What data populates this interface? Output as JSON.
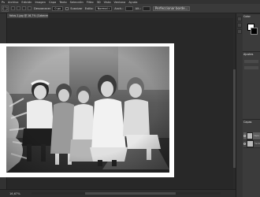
{
  "menu": [
    "Ps",
    "Archivo",
    "Edición",
    "Imagen",
    "Capa",
    "Texto",
    "Selección",
    "Filtro",
    "3D",
    "Vista",
    "Ventana",
    "Ayuda"
  ],
  "options": {
    "feather_label": "Desvanecer",
    "feather_value": "0 px",
    "antialias_label": "Suavizar",
    "style_label": "Estilo:",
    "style_value": "Normal",
    "width_label": "Anch.:",
    "height_label": "Alt.:",
    "refine_label": "Perfeccionar borde..."
  },
  "document": {
    "tab_label": "fotos-1.jpg @ 16,7% (Cabecera 1, RGB/8)",
    "zoom": "16,67%"
  },
  "panels": {
    "color_tab": "Color",
    "adjust_tab": "Ajustes",
    "layers_tab": "Capas",
    "layer_names": [
      "Capa 1",
      "Fondo"
    ]
  },
  "colors": {
    "foreground": "#ffffff",
    "background": "#000000"
  }
}
